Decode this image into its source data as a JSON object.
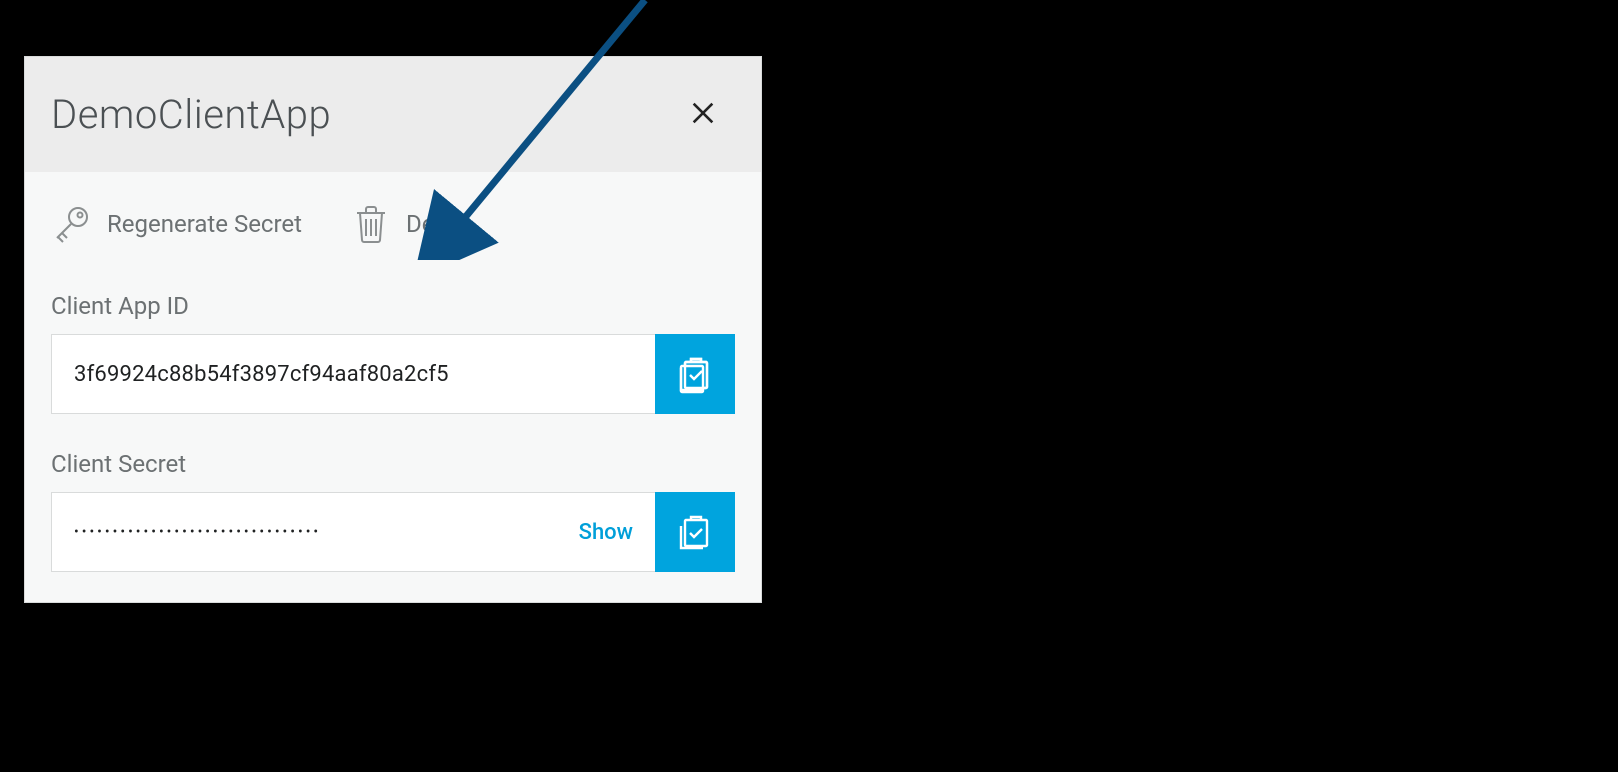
{
  "panel": {
    "title": "DemoClientApp"
  },
  "actions": {
    "regenerate_label": "Regenerate Secret",
    "delete_label": "Delete"
  },
  "client_app_id": {
    "label": "Client App ID",
    "value": "3f69924c88b54f3897cf94aaf80a2cf5"
  },
  "client_secret": {
    "label": "Client Secret",
    "masked_value": "••••••••••••••••••••••••••••••••",
    "show_label": "Show"
  }
}
